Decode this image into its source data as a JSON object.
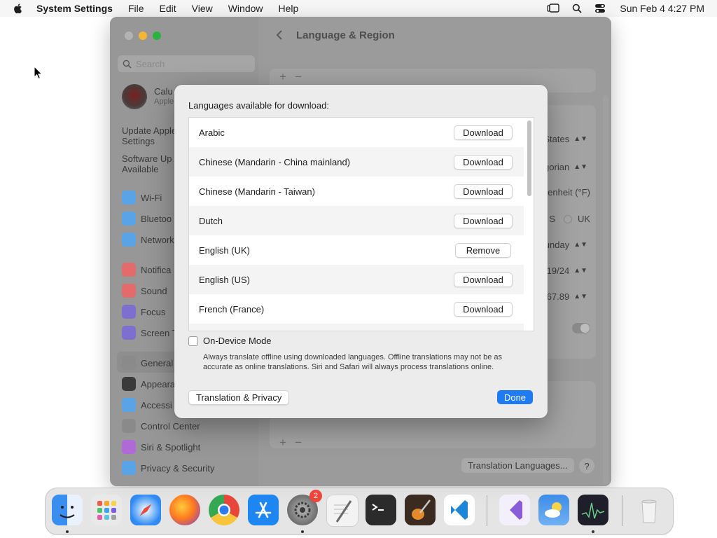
{
  "menubar": {
    "app_name": "System Settings",
    "items": [
      "File",
      "Edit",
      "View",
      "Window",
      "Help"
    ],
    "clock": "Sun Feb 4  4:27 PM"
  },
  "window": {
    "title": "Language & Region",
    "search_placeholder": "Search",
    "account": {
      "name": "Calu",
      "sub": "Apple"
    },
    "notes": [
      {
        "text": "Update Apple\nSettings"
      },
      {
        "text": "Software Up\nAvailable"
      }
    ],
    "sidebar_items": [
      {
        "label": "Wi-Fi",
        "color": "#5aa3e6"
      },
      {
        "label": "Bluetoo",
        "color": "#5aa3e6"
      },
      {
        "label": "Network",
        "color": "#5aa3e6"
      },
      {
        "label": "Notifica",
        "color": "#e36b6b"
      },
      {
        "label": "Sound",
        "color": "#e36b6b"
      },
      {
        "label": "Focus",
        "color": "#7d6fd0"
      },
      {
        "label": "Screen T",
        "color": "#7d6fd0"
      },
      {
        "label": "General",
        "color": "#8a8a8a"
      },
      {
        "label": "Appeara",
        "color": "#3a3a3a"
      },
      {
        "label": "Accessi",
        "color": "#5aa3e6"
      },
      {
        "label": "Control Center",
        "color": "#8a8a8a"
      },
      {
        "label": "Siri & Spotlight",
        "color": "#b06ad6"
      },
      {
        "label": "Privacy & Security",
        "color": "#5aa3e6"
      }
    ],
    "main_values": [
      "States",
      "egorian",
      "enheit (°F)",
      "S",
      "UK",
      "Sunday",
      "/19/24",
      "567.89"
    ],
    "translation_languages_button": "Translation Languages...",
    "help_label": "?"
  },
  "modal": {
    "heading": "Languages available for download:",
    "languages": [
      {
        "name": "Arabic",
        "action": "Download"
      },
      {
        "name": "Chinese (Mandarin - China mainland)",
        "action": "Download"
      },
      {
        "name": "Chinese (Mandarin - Taiwan)",
        "action": "Download"
      },
      {
        "name": "Dutch",
        "action": "Download"
      },
      {
        "name": "English (UK)",
        "action": "Remove"
      },
      {
        "name": "English (US)",
        "action": "Download"
      },
      {
        "name": "French (France)",
        "action": "Download"
      }
    ],
    "on_device_label": "On-Device Mode",
    "on_device_checked": false,
    "on_device_description": "Always translate offline using downloaded languages. Offline translations may not be as accurate as online translations. Siri and Safari will always process translations online.",
    "privacy_button": "Translation & Privacy",
    "done_button": "Done",
    "accent_color": "#1f7bf4"
  },
  "dock": {
    "apps": [
      {
        "name": "finder-icon",
        "color": "#3a8ef0"
      },
      {
        "name": "launchpad-icon",
        "color": "#e9e9e9"
      },
      {
        "name": "safari-icon",
        "color": "#2f8bf2"
      },
      {
        "name": "firefox-icon",
        "color": "#7b3bd9"
      },
      {
        "name": "chrome-icon",
        "color": "#ffffff"
      },
      {
        "name": "app-store-icon",
        "color": "#1e86f0"
      },
      {
        "name": "system-settings-icon",
        "color": "#8d8d8d"
      },
      {
        "name": "textedit-icon",
        "color": "#f3f3f3"
      },
      {
        "name": "terminal-icon",
        "color": "#2b2b2b"
      },
      {
        "name": "garageband-icon",
        "color": "#3a2a1f"
      },
      {
        "name": "vscode-icon",
        "color": "#ffffff"
      },
      {
        "name": "visual-studio-icon",
        "color": "#f4f0fb"
      },
      {
        "name": "weather-icon",
        "color": "#3d8ce8"
      },
      {
        "name": "activity-monitor-icon",
        "color": "#1f1f2b"
      },
      {
        "name": "trash-icon",
        "color": "#ececec"
      }
    ],
    "settings_badge": "2"
  }
}
